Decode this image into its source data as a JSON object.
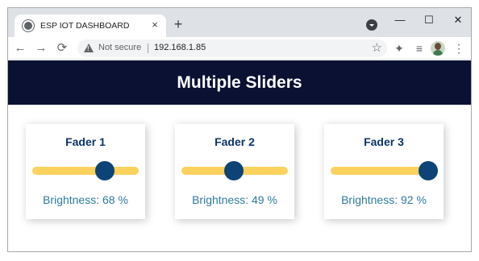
{
  "browser": {
    "tab_title": "ESP IOT DASHBOARD",
    "tab_close": "×",
    "new_tab": "+",
    "window_controls": {
      "minimize": "—",
      "maximize": "☐",
      "close": "✕"
    },
    "nav": {
      "back": "←",
      "forward": "→",
      "reload": "⟳"
    },
    "security_label": "Not secure",
    "url": "192.168.1.85",
    "bookmark_star": "☆",
    "extensions_icon": "✦",
    "media_icon": "≡",
    "menu_icon": "⋮"
  },
  "page": {
    "title": "Multiple Sliders",
    "header_color": "#0a1133",
    "faders": [
      {
        "title": "Fader 1",
        "value": 68,
        "label": "Brightness: 68 %"
      },
      {
        "title": "Fader 2",
        "value": 49,
        "label": "Brightness: 49 %"
      },
      {
        "title": "Fader 3",
        "value": 92,
        "label": "Brightness: 92 %"
      }
    ],
    "colors": {
      "track": "#fbd25e",
      "knob": "#0d4377",
      "title": "#0d3466",
      "label": "#2f7a9c"
    }
  }
}
